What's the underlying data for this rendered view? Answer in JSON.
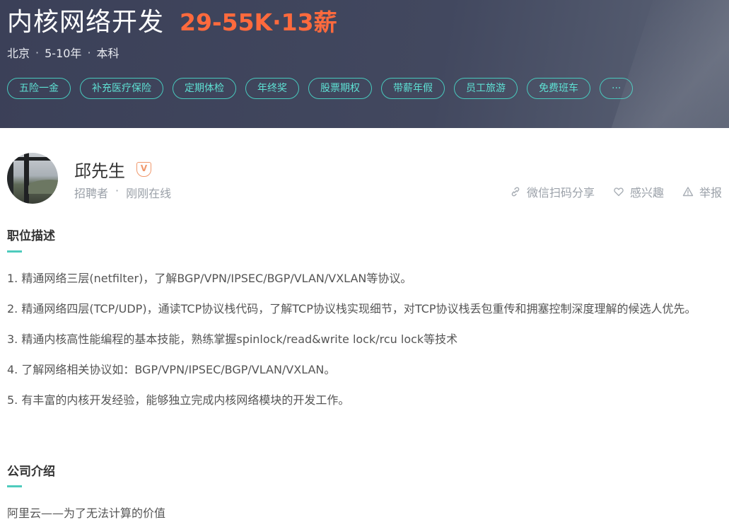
{
  "job": {
    "title": "内核网络开发",
    "salary": "29-55K·13薪",
    "meta": [
      "北京",
      "5-10年",
      "本科"
    ],
    "meta_separator": "·",
    "tags": [
      "五险一金",
      "补充医疗保险",
      "定期体检",
      "年终奖",
      "股票期权",
      "带薪年假",
      "员工旅游",
      "免费班车",
      "···"
    ]
  },
  "recruiter": {
    "name": "邱先生",
    "badge": "V",
    "role": "招聘者",
    "sep": "·",
    "status": "刚刚在线",
    "actions": {
      "share": "微信扫码分享",
      "interest": "感兴趣",
      "report": "举报"
    }
  },
  "description": {
    "title": "职位描述",
    "lines": [
      "1. 精通网络三层(netfilter)，了解BGP/VPN/IPSEC/BGP/VLAN/VXLAN等协议。",
      "2. 精通网络四层(TCP/UDP)，通读TCP协议栈代码，了解TCP协议栈实现细节，对TCP协议栈丢包重传和拥塞控制深度理解的候选人优先。",
      "3. 精通内核高性能编程的基本技能，熟练掌握spinlock/read&write lock/rcu lock等技术",
      "4. 了解网络相关协议如：BGP/VPN/IPSEC/BGP/VLAN/VXLAN。",
      "5. 有丰富的内核开发经验，能够独立完成内核网络模块的开发工作。"
    ]
  },
  "company": {
    "title": "公司介绍",
    "intro": "阿里云——为了无法计算的价值"
  },
  "colors": {
    "header_bg": "#42485f",
    "salary": "#ff6a3d",
    "tag_accent": "#48c9bd",
    "badge": "#f0986c"
  }
}
